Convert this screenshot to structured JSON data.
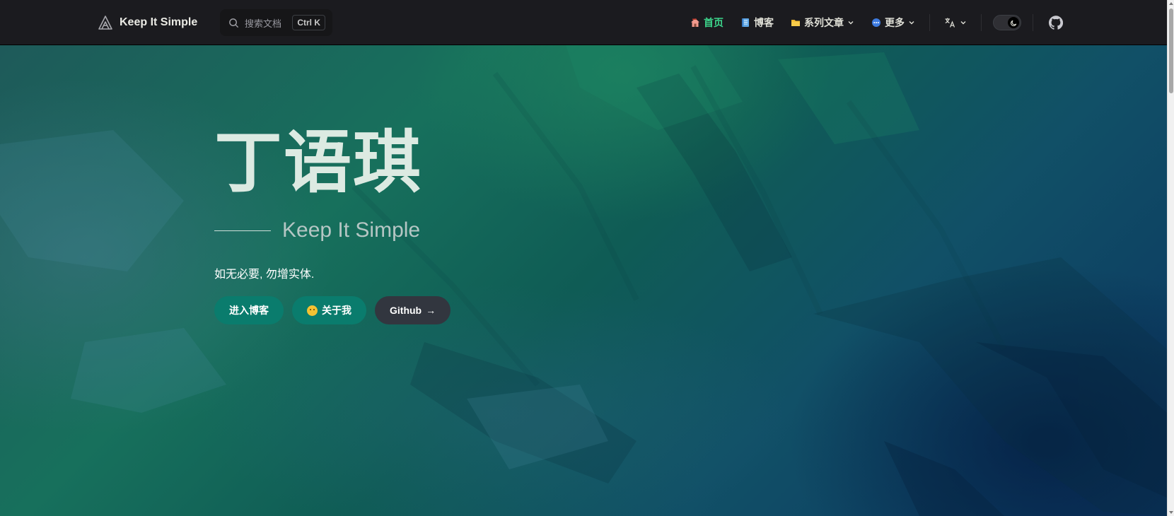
{
  "brand": {
    "title": "Keep It Simple",
    "icon": "mountain-logo-icon"
  },
  "search": {
    "placeholder": "搜索文档",
    "shortcut": "Ctrl K"
  },
  "nav": {
    "items": [
      {
        "label": "首页",
        "icon": "house-icon",
        "active": true
      },
      {
        "label": "博客",
        "icon": "notebook-icon"
      },
      {
        "label": "系列文章",
        "icon": "folder-icon",
        "dropdown": true
      },
      {
        "label": "更多",
        "icon": "dots-icon",
        "dropdown": true
      }
    ],
    "translate_icon": "translate-icon",
    "theme_icon": "moon-icon",
    "github_icon": "github-icon"
  },
  "hero": {
    "name": "丁语琪",
    "tagline": "Keep It Simple",
    "description": "如无必要, 勿增实体.",
    "actions": [
      {
        "label": "进入博客",
        "theme": "brand"
      },
      {
        "label": "关于我",
        "theme": "brand",
        "icon": "smiley-icon"
      },
      {
        "label": "Github",
        "theme": "alt",
        "icon": "arrow-right-icon",
        "arrow": "→"
      }
    ]
  },
  "colors": {
    "nav_bg": "#1b1b1f",
    "active": "#3dd68c",
    "brand_button": "#0a7c6d",
    "alt_button": "#32363f"
  }
}
